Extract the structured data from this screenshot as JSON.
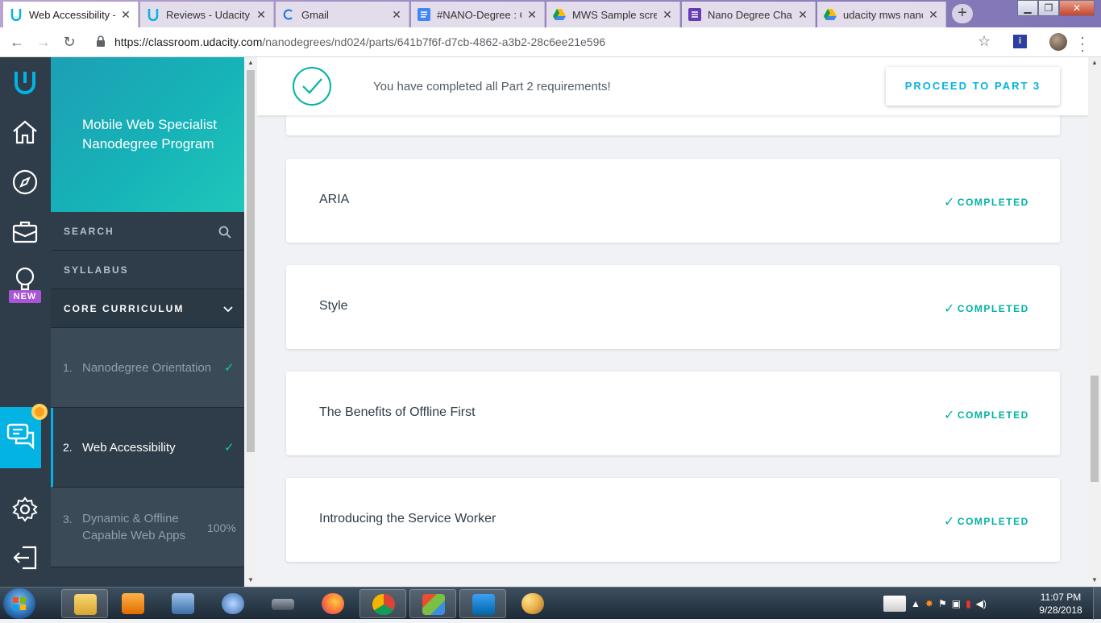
{
  "browser": {
    "tabs": [
      {
        "label": "Web Accessibility -",
        "icon": "udacity-icon",
        "active": true
      },
      {
        "label": "Reviews - Udacity",
        "icon": "udacity-icon",
        "active": false
      },
      {
        "label": "Gmail",
        "icon": "loading-icon",
        "active": false
      },
      {
        "label": "#NANO-Degree : C",
        "icon": "docs-icon",
        "active": false
      },
      {
        "label": "MWS Sample scree",
        "icon": "drive-icon",
        "active": false
      },
      {
        "label": "Nano Degree Chall",
        "icon": "forms-icon",
        "active": false
      },
      {
        "label": "udacity mws nanod",
        "icon": "drive-icon",
        "active": false
      }
    ],
    "url_host": "https://classroom.udacity.com",
    "url_path": "/nanodegrees/nd024/parts/641b7f6f-d7cb-4862-a3b2-28c6ee21e596"
  },
  "rail": {
    "new_badge": "NEW",
    "icons": [
      "udacity-logo",
      "home-icon",
      "compass-icon",
      "briefcase-icon",
      "lightbulb-icon",
      "chat-icon",
      "gear-icon",
      "logout-icon"
    ]
  },
  "panel": {
    "program_title": "Mobile Web Specialist Nanodegree Program",
    "search_label": "SEARCH",
    "syllabus_label": "SYLLABUS",
    "core_label": "CORE CURRICULUM",
    "lessons": [
      {
        "num": "1.",
        "name": "Nanodegree Orientation",
        "status": "✓",
        "active": false
      },
      {
        "num": "2.",
        "name": "Web Accessibility",
        "status": "✓",
        "active": true
      },
      {
        "num": "3.",
        "name": "Dynamic & Offline Capable Web Apps",
        "status": "100%",
        "active": false
      }
    ]
  },
  "main": {
    "banner_message": "You have completed all Part 2 requirements!",
    "proceed_label": "PROCEED TO PART 3",
    "cards": [
      {
        "title": "ARIA",
        "status": "COMPLETED"
      },
      {
        "title": "Style",
        "status": "COMPLETED"
      },
      {
        "title": "The Benefits of Offline First",
        "status": "COMPLETED"
      },
      {
        "title": "Introducing the Service Worker",
        "status": "COMPLETED"
      }
    ]
  },
  "taskbar": {
    "time": "11:07 PM",
    "date": "9/28/2018",
    "apps": [
      "explorer",
      "media-player",
      "keyboard",
      "fingerprint",
      "scanner",
      "firefox",
      "chrome",
      "git",
      "vscode",
      "paint"
    ]
  },
  "colors": {
    "accent_teal": "#02b3a4",
    "accent_blue": "#02b3e4",
    "sidebar_dark": "#2e3d49"
  }
}
